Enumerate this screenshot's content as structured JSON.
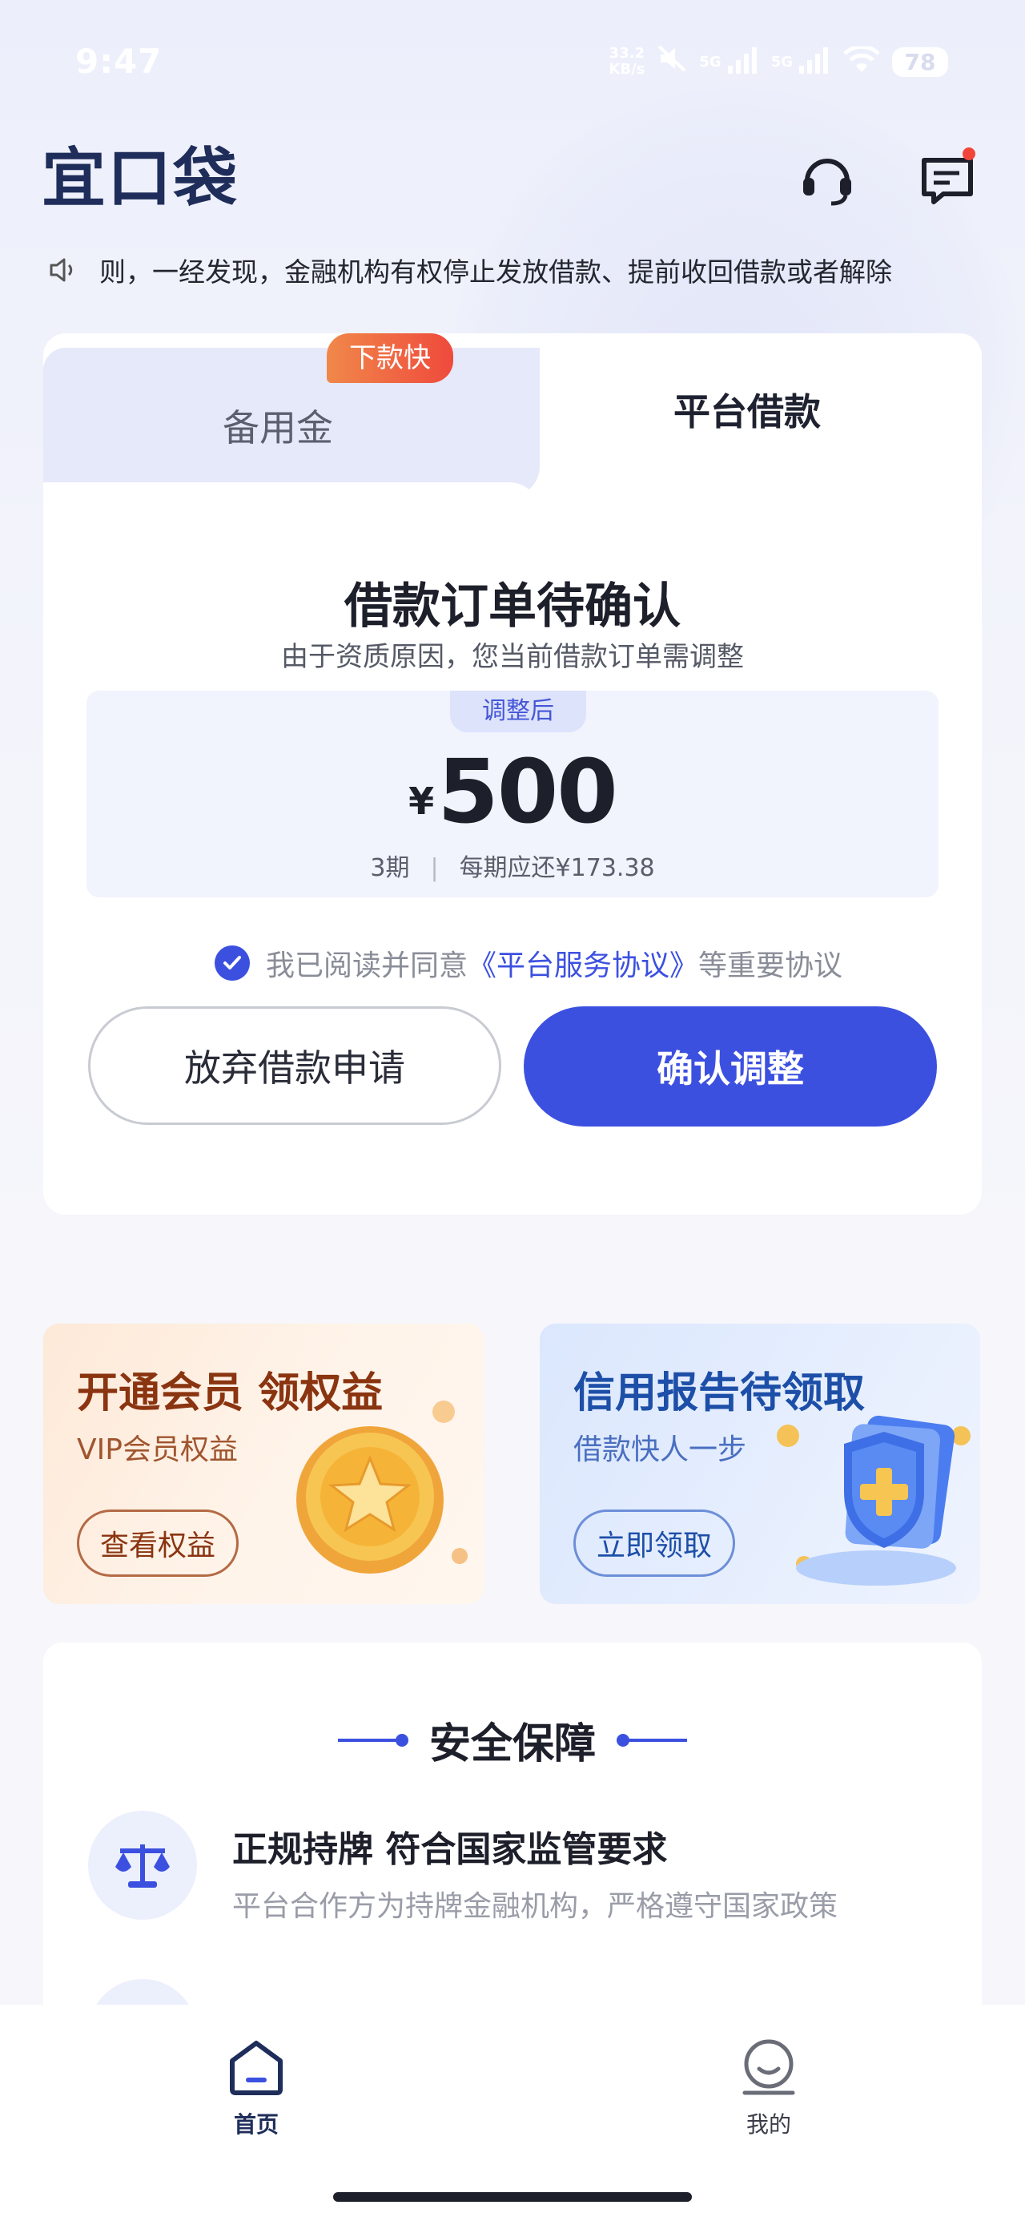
{
  "status_bar": {
    "time": "9:47",
    "net_speed": "33.2\nKB/s",
    "battery": "78",
    "network": "5G"
  },
  "header": {
    "logo": "宜口袋",
    "headset_icon": "headset-icon",
    "message_icon": "message-icon"
  },
  "notice": {
    "text": "则，一经发现，金融机构有权停止发放借款、提前收回借款或者解除"
  },
  "tabs": {
    "left_label": "备用金",
    "left_badge": "下款快",
    "right_label": "平台借款"
  },
  "order": {
    "title": "借款订单待确认",
    "subtitle": "由于资质原因，您当前借款订单需调整",
    "tag": "调整后",
    "currency": "¥",
    "amount": "500",
    "periods": "3期",
    "per_period": "每期应还¥173.38"
  },
  "agreement": {
    "prefix": "我已阅读并同意",
    "link": "《平台服务协议》",
    "suffix": "等重要协议"
  },
  "buttons": {
    "abandon": "放弃借款申请",
    "confirm": "确认调整"
  },
  "promos": {
    "vip": {
      "title": "开通会员 领权益",
      "subtitle": "VIP会员权益",
      "button": "查看权益"
    },
    "credit": {
      "title": "信用报告待领取",
      "subtitle": "借款快人一步",
      "button": "立即领取"
    }
  },
  "security": {
    "title": "安全保障",
    "items": [
      {
        "title": "正规持牌 符合国家监管要求",
        "desc": "平台合作方为持牌金融机构，严格遵守国家政策"
      }
    ]
  },
  "nav": {
    "home": "首页",
    "mine": "我的"
  },
  "colors": {
    "primary": "#3c50e0",
    "logo": "#1f2d5a",
    "badge_start": "#f0884a",
    "badge_end": "#ef4a3c"
  }
}
